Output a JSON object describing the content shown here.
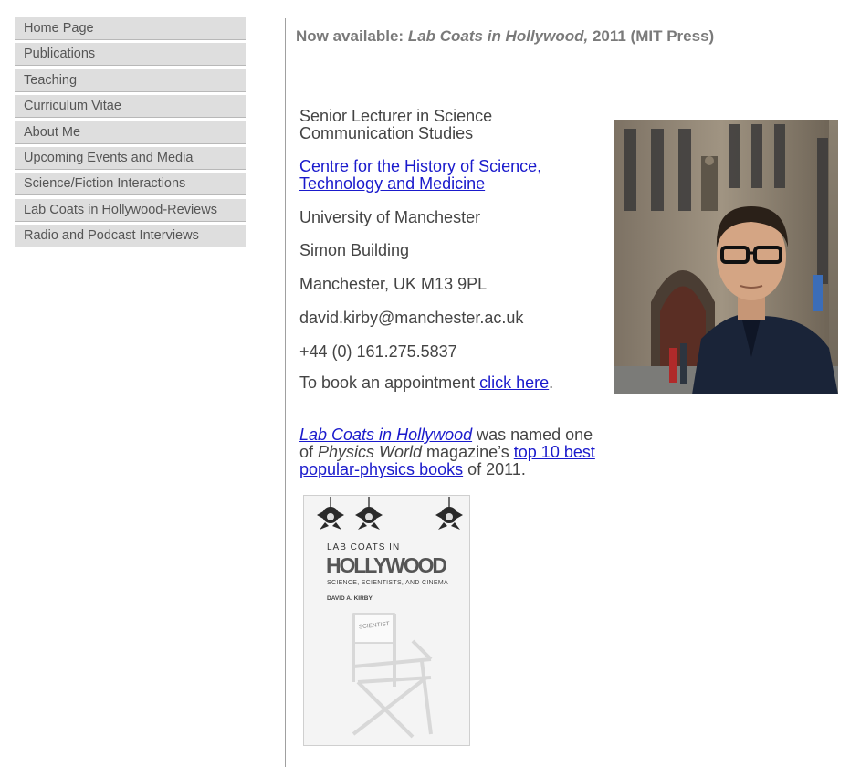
{
  "nav": {
    "items": [
      "Home Page",
      "Publications",
      "Teaching",
      "Curriculum Vitae",
      "About Me",
      "Upcoming Events and Media",
      "Science/Fiction Interactions",
      "Lab Coats in Hollywood-Reviews",
      "Radio and Podcast Interviews"
    ]
  },
  "banner": {
    "prefix": "Now available: ",
    "title": "Lab Coats in Hollywood,",
    "suffix": " 2011 (MIT Press)"
  },
  "info": {
    "position": "Senior Lecturer in Science Communication Studies",
    "centre_link": "Centre for the History of Science, Technology and Medicine",
    "university": "University of Manchester",
    "building": "Simon Building",
    "address": "Manchester, UK M13 9PL",
    "email": "david.kirby@manchester.ac.uk",
    "phone": "+44 (0) 161.275.5837",
    "appointment_text": "To book an appointment ",
    "appointment_link": "click here",
    "appointment_end": "."
  },
  "award": {
    "book_link": "Lab Coats in Hollywood",
    "text1": " was named one of ",
    "magazine": "Physics World",
    "text2": " magazine’s ",
    "list_link": "top 10 best popular-physics books",
    "text3": " of 2011."
  },
  "book_cover": {
    "line1": "LAB COATS IN",
    "line2": "HOLLYWOOD",
    "subtitle": "SCIENCE, SCIENTISTS, AND CINEMA",
    "author": "DAVID A. KIRBY",
    "chair_label": "SCIENTIST"
  },
  "colors": {
    "nav_bg": "#dedede",
    "link": "#1a1acc",
    "banner": "#7a7a7a"
  }
}
